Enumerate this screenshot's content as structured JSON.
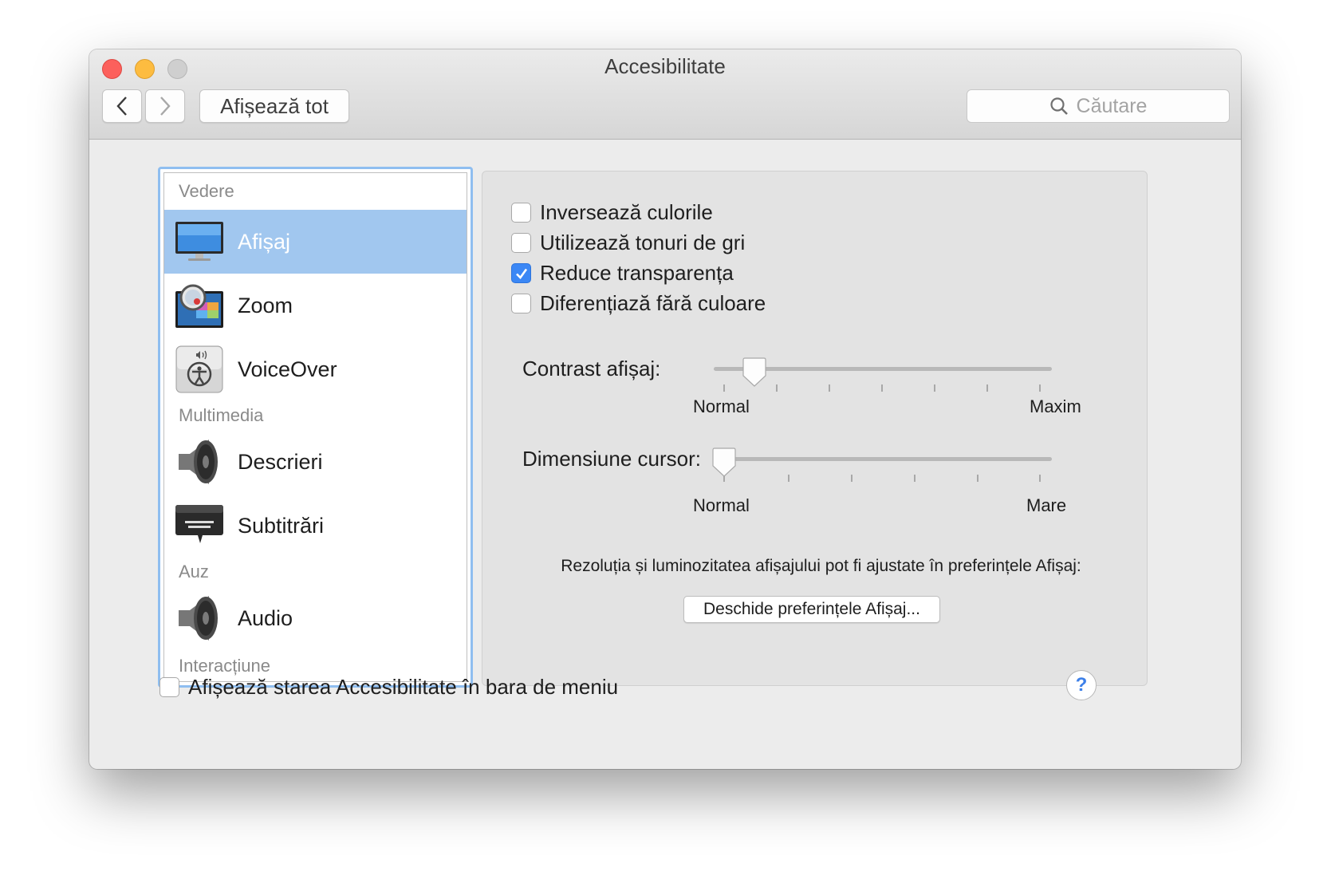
{
  "window": {
    "title": "Accesibilitate"
  },
  "toolbar": {
    "show_all": "Afișează tot",
    "search_placeholder": "Căutare"
  },
  "sidebar": {
    "sections": [
      {
        "label": "Vedere",
        "items": [
          {
            "label": "Afișaj",
            "icon": "display-icon",
            "selected": true
          },
          {
            "label": "Zoom",
            "icon": "zoom-icon"
          },
          {
            "label": "VoiceOver",
            "icon": "voiceover-icon"
          }
        ]
      },
      {
        "label": "Multimedia",
        "items": [
          {
            "label": "Descrieri",
            "icon": "speaker-icon"
          },
          {
            "label": "Subtitrări",
            "icon": "captions-icon"
          }
        ]
      },
      {
        "label": "Auz",
        "items": [
          {
            "label": "Audio",
            "icon": "speaker-icon"
          }
        ]
      },
      {
        "label": "Interacțiune",
        "items": []
      }
    ]
  },
  "display": {
    "checkboxes": [
      {
        "label": "Inversează culorile",
        "checked": false
      },
      {
        "label": "Utilizează tonuri de gri",
        "checked": false
      },
      {
        "label": "Reduce transparența",
        "checked": true
      },
      {
        "label": "Diferențiază fără culoare",
        "checked": false
      }
    ],
    "contrast": {
      "label": "Contrast afișaj:",
      "min_label": "Normal",
      "max_label": "Maxim",
      "value": 0.12
    },
    "cursor": {
      "label": "Dimensiune cursor:",
      "min_label": "Normal",
      "max_label": "Mare",
      "value": 0.0
    },
    "note": "Rezoluția și luminozitatea afișajului pot fi ajustate în preferințele Afișaj:",
    "open_button": "Deschide preferințele Afișaj..."
  },
  "footer": {
    "menu_status_label": "Afișează starea Accesibilitate în bara de meniu",
    "menu_status_checked": false,
    "help": "?"
  },
  "colors": {
    "accent": "#3b87f5",
    "selection": "#a1c7ef"
  }
}
